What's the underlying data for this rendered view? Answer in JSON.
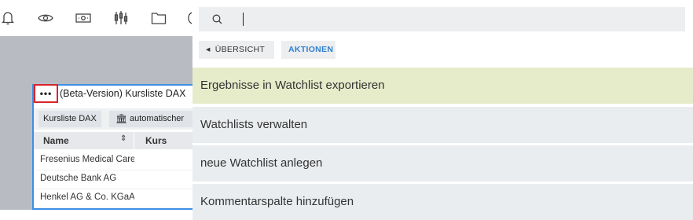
{
  "toolbar": {
    "icons": [
      "bell-icon",
      "eye-icon",
      "banknote-icon",
      "candlestick-chart-icon",
      "folder-icon"
    ]
  },
  "widget": {
    "menu_button": "•••",
    "title": "(Beta-Version) Kursliste DAX",
    "chips": [
      "Kursliste DAX",
      "automatischer"
    ],
    "columns": [
      "Name",
      "Kurs"
    ],
    "sort_symbol": "⇕",
    "rows": [
      "Fresenius Medical Care",
      "Deutsche Bank AG",
      "Henkel AG & Co. KGaA"
    ]
  },
  "search": {
    "value": "",
    "placeholder": ""
  },
  "tabs": {
    "back_label": "ÜBERSICHT",
    "actions_label": "AKTIONEN"
  },
  "menu": [
    "Ergebnisse in Watchlist exportieren",
    "Watchlists verwalten",
    "neue Watchlist anlegen",
    "Kommentarspalte hinzufügen"
  ],
  "colors": {
    "accent_blue": "#2f80d1",
    "highlight": "#e6ecca",
    "annotation_red": "#d6262a",
    "widget_border": "#3f8fe6"
  }
}
